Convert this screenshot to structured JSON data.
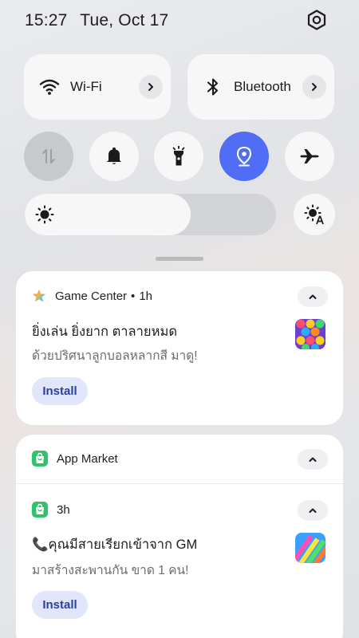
{
  "status_bar": {
    "time": "15:27",
    "date": "Tue, Oct 17"
  },
  "quick_tiles": {
    "wifi": {
      "label": "Wi-Fi"
    },
    "bluetooth": {
      "label": "Bluetooth"
    }
  },
  "toggles": [
    {
      "name": "mobile-data",
      "state": "off"
    },
    {
      "name": "do-not-disturb",
      "state": "available"
    },
    {
      "name": "flashlight",
      "state": "available"
    },
    {
      "name": "location",
      "state": "on"
    },
    {
      "name": "airplane-mode",
      "state": "available"
    }
  ],
  "brightness": {
    "level": 0.66
  },
  "colors": {
    "accent": "#4f6df5",
    "button_bg": "#e1e6fb",
    "button_text": "#2c3e9e"
  },
  "notifications": [
    {
      "app": "Game Center",
      "time": "1h",
      "title": "ยิ่งเล่น ยิ่งยาก ตาลายหมด",
      "text": "ด้วยปริศนาลูกบอลหลากสี มาดู!",
      "action": "Install"
    },
    {
      "app": "App Market",
      "time": "3h",
      "title": "📞คุณมีสายเรียกเข้าจาก GM",
      "text": "มาสร้างสะพานกัน ขาด 1 คน!",
      "action": "Install"
    }
  ]
}
